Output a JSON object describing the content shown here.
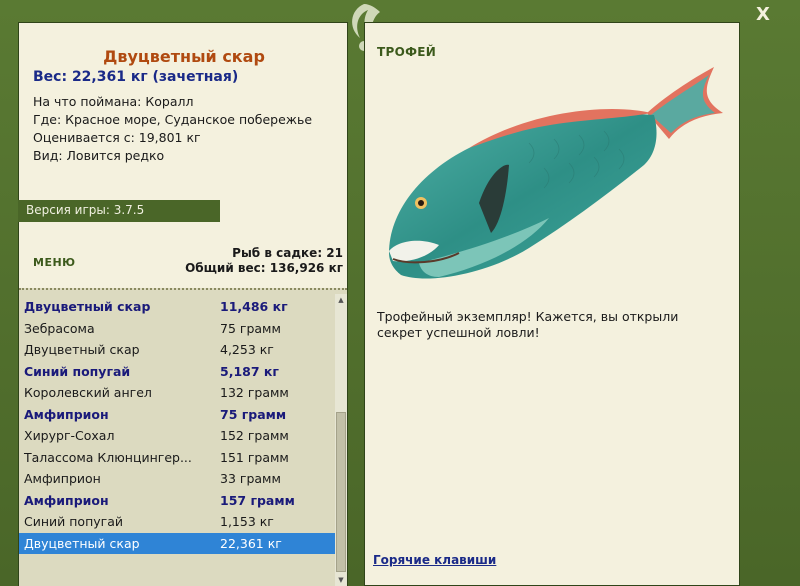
{
  "fish_info": {
    "title": "Двуцветный скар",
    "weight_line": "Вес: 22,361 кг (зачетная)",
    "caught_on": "На что поймана: Коралл",
    "where": "Где: Красное море, Суданское побережье",
    "valued_from": "Оценивается с: 19,801 кг",
    "kind": "Вид: Ловится редко"
  },
  "version": "Версия игры: 3.7.5",
  "menu_label": "МЕНЮ",
  "stats": {
    "fish_count": "Рыб в садке: 21",
    "total_weight": "Общий вес: 136,926 кг"
  },
  "catch_list": [
    {
      "name": "Двуцветный скар",
      "weight": "11,486 кг",
      "highlight": true
    },
    {
      "name": "Зебрасома",
      "weight": "75 грамм",
      "highlight": false
    },
    {
      "name": "Двуцветный скар",
      "weight": "4,253 кг",
      "highlight": false
    },
    {
      "name": "Синий попугай",
      "weight": "5,187 кг",
      "highlight": true
    },
    {
      "name": "Королевский ангел",
      "weight": "132 грамм",
      "highlight": false
    },
    {
      "name": "Амфиприон",
      "weight": "75 грамм",
      "highlight": true
    },
    {
      "name": "Хирург-Сохал",
      "weight": "152 грамм",
      "highlight": false
    },
    {
      "name": "Талассома Клюнцингер...",
      "weight": "151 грамм",
      "highlight": false
    },
    {
      "name": "Амфиприон",
      "weight": "33 грамм",
      "highlight": false
    },
    {
      "name": "Амфиприон",
      "weight": "157 грамм",
      "highlight": true
    },
    {
      "name": "Синий попугай",
      "weight": "1,153 кг",
      "highlight": false
    },
    {
      "name": "Двуцветный скар",
      "weight": "22,361 кг",
      "highlight": false,
      "selected": true
    }
  ],
  "trophy": {
    "heading": "ТРОФЕЙ",
    "description": "Трофейный экземпляр! Кажется, вы открыли секрет успешной ловли!"
  },
  "hotkeys_label": "Горячие клавиши",
  "close_label": "X",
  "colors": {
    "frame": "#4e6b2b",
    "panel": "#f4f1de",
    "title": "#b04a10",
    "accent_blue": "#1a2a88",
    "selection": "#2f84d6"
  }
}
